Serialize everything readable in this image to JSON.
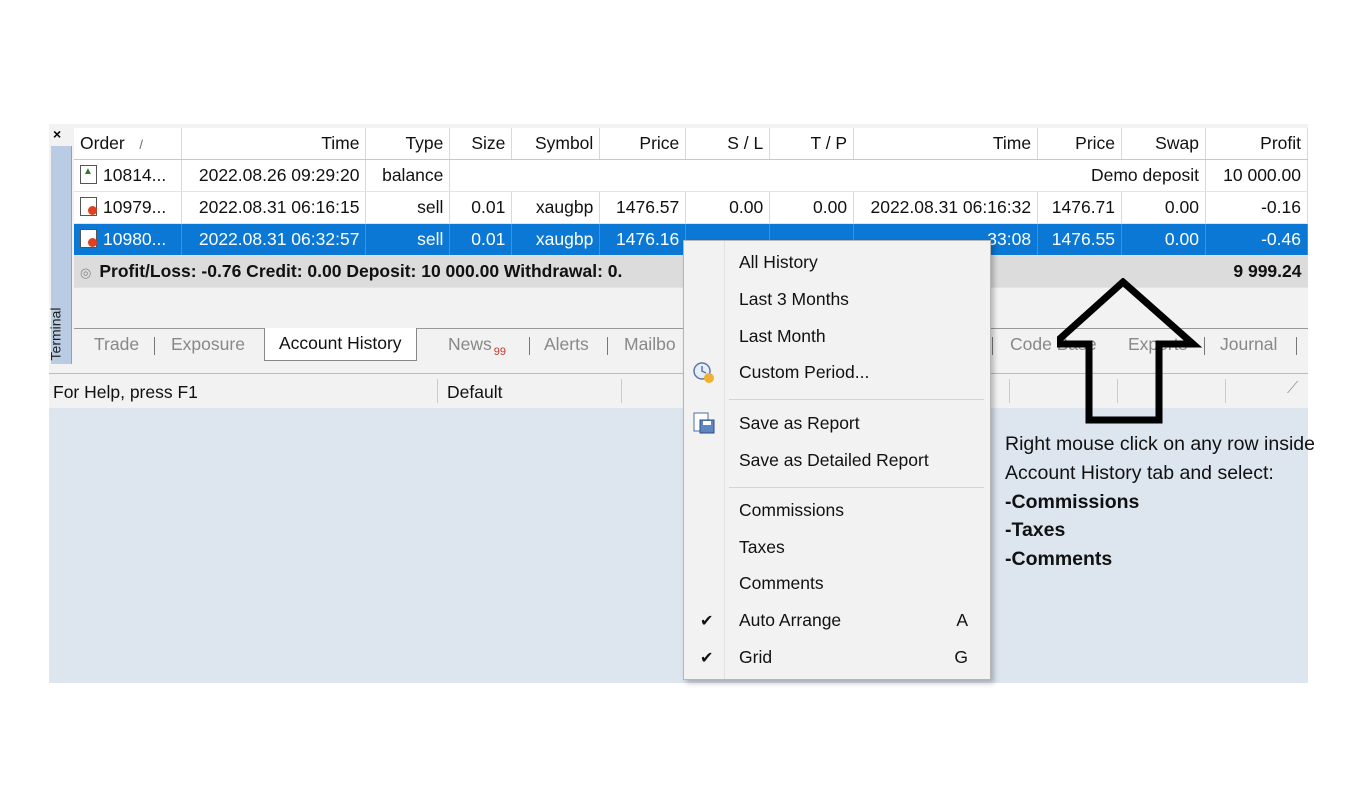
{
  "terminal": {
    "close_label": "×",
    "side_label": "Terminal",
    "columns": [
      "Order",
      "/",
      "Time",
      "Type",
      "Size",
      "Symbol",
      "Price",
      "S / L",
      "T / P",
      "Time",
      "Price",
      "Swap",
      "Profit"
    ],
    "rows": [
      {
        "order": "10814...",
        "time": "2022.08.26 09:29:20",
        "type": "balance",
        "comment": "Demo deposit",
        "profit": "10 000.00"
      },
      {
        "order": "10979...",
        "time": "2022.08.31 06:16:15",
        "type": "sell",
        "size": "0.01",
        "symbol": "xaugbp",
        "price": "1476.57",
        "sl": "0.00",
        "tp": "0.00",
        "close_time": "2022.08.31 06:16:32",
        "close_price": "1476.71",
        "swap": "0.00",
        "profit": "-0.16"
      },
      {
        "order": "10980...",
        "time": "2022.08.31 06:32:57",
        "type": "sell",
        "size": "0.01",
        "symbol": "xaugbp",
        "price": "1476.16",
        "close_time": "33:08",
        "close_price": "1476.55",
        "swap": "0.00",
        "profit": "-0.46"
      }
    ],
    "summary": {
      "text": "Profit/Loss: -0.76  Credit: 0.00  Deposit: 10 000.00  Withdrawal: 0.",
      "total": "9 999.24"
    },
    "tabs": {
      "trade": "Trade",
      "exposure": "Exposure",
      "account_history": "Account History",
      "news": "News",
      "news_badge": "99",
      "alerts": "Alerts",
      "mailbox": "Mailbo",
      "codebase": "Code Base",
      "experts": "Experts",
      "journal": "Journal"
    },
    "status": {
      "help": "For Help, press F1",
      "profile": "Default"
    }
  },
  "context_menu": {
    "items": {
      "all_history": "All History",
      "last_3_months": "Last 3 Months",
      "last_month": "Last Month",
      "custom_period": "Custom Period...",
      "save_report": "Save as Report",
      "save_detailed": "Save as Detailed Report",
      "commissions": "Commissions",
      "taxes": "Taxes",
      "comments": "Comments",
      "auto_arrange": "Auto Arrange",
      "auto_arrange_key": "A",
      "grid": "Grid",
      "grid_key": "G"
    },
    "checked": [
      "auto_arrange",
      "grid"
    ],
    "icons": [
      "clock-icon",
      "save-report-icon",
      "checkmark-icon"
    ]
  },
  "annotation": {
    "line1": "Right mouse click on any row inside Account History tab and select:",
    "item1": "-Commissions",
    "item2": "-Taxes",
    "item3": "-Comments"
  },
  "colors": {
    "selection": "#0a78d4",
    "panel_bg": "#dde5ef",
    "sidebar": "#b9cce3"
  }
}
